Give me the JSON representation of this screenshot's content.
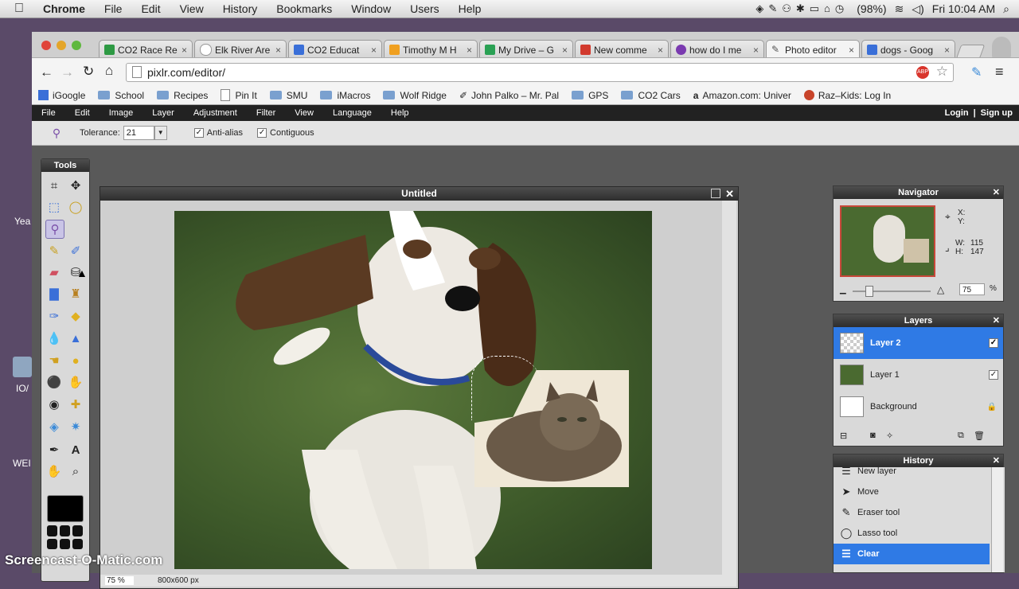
{
  "mac_menubar": {
    "app": "Chrome",
    "items": [
      "File",
      "Edit",
      "View",
      "History",
      "Bookmarks",
      "Window",
      "Users",
      "Help"
    ],
    "battery": "(98%)",
    "clock": "Fri 10:04 AM"
  },
  "desktop": {
    "labels": [
      "Yea",
      "IO/",
      "WEI"
    ]
  },
  "tabs": [
    {
      "label": "CO2 Race Re",
      "color": "#2e9a44"
    },
    {
      "label": "Elk River Are",
      "color": "#ffffff"
    },
    {
      "label": "CO2 Educat",
      "color": "#3a6fd8"
    },
    {
      "label": "Timothy M H",
      "color": "#f0a020"
    },
    {
      "label": "My Drive – G",
      "color": "#2aa154"
    },
    {
      "label": "New comme",
      "color": "#d23a2e"
    },
    {
      "label": "how do I me",
      "color": "#7a3ab0"
    },
    {
      "label": "Photo editor",
      "color": "#555555"
    },
    {
      "label": "dogs - Goog",
      "color": "#3a6fd8"
    }
  ],
  "url": "pixlr.com/editor/",
  "bookmarks": [
    "iGoogle",
    "School",
    "Recipes",
    "Pin It",
    "SMU",
    "iMacros",
    "Wolf Ridge",
    "John Palko – Mr. Pal",
    "GPS",
    "CO2 Cars",
    "Amazon.com: Univer",
    "Raz–Kids: Log In"
  ],
  "pixlr_menu": {
    "items": [
      "File",
      "Edit",
      "Image",
      "Layer",
      "Adjustment",
      "Filter",
      "View",
      "Language",
      "Help"
    ],
    "login": "Login",
    "separator": "|",
    "signup": "Sign up"
  },
  "options": {
    "tolerance_label": "Tolerance:",
    "tolerance_value": "21",
    "antialias": "Anti-alias",
    "contiguous": "Contiguous"
  },
  "tools_title": "Tools",
  "canvas": {
    "title": "Untitled",
    "zoom": "75",
    "zoom_unit": "%",
    "size": "800x600 px"
  },
  "navigator": {
    "title": "Navigator",
    "x_label": "X:",
    "y_label": "Y:",
    "w_label": "W:",
    "w_value": "115",
    "h_label": "H:",
    "h_value": "147",
    "zoom": "75",
    "zoom_unit": "%"
  },
  "layers": {
    "title": "Layers",
    "items": [
      "Layer 2",
      "Layer 1",
      "Background"
    ]
  },
  "history": {
    "title": "History",
    "items": [
      "New layer",
      "Move",
      "Eraser tool",
      "Lasso tool",
      "Clear"
    ]
  },
  "watermark": "Screencast-O-Matic.com"
}
